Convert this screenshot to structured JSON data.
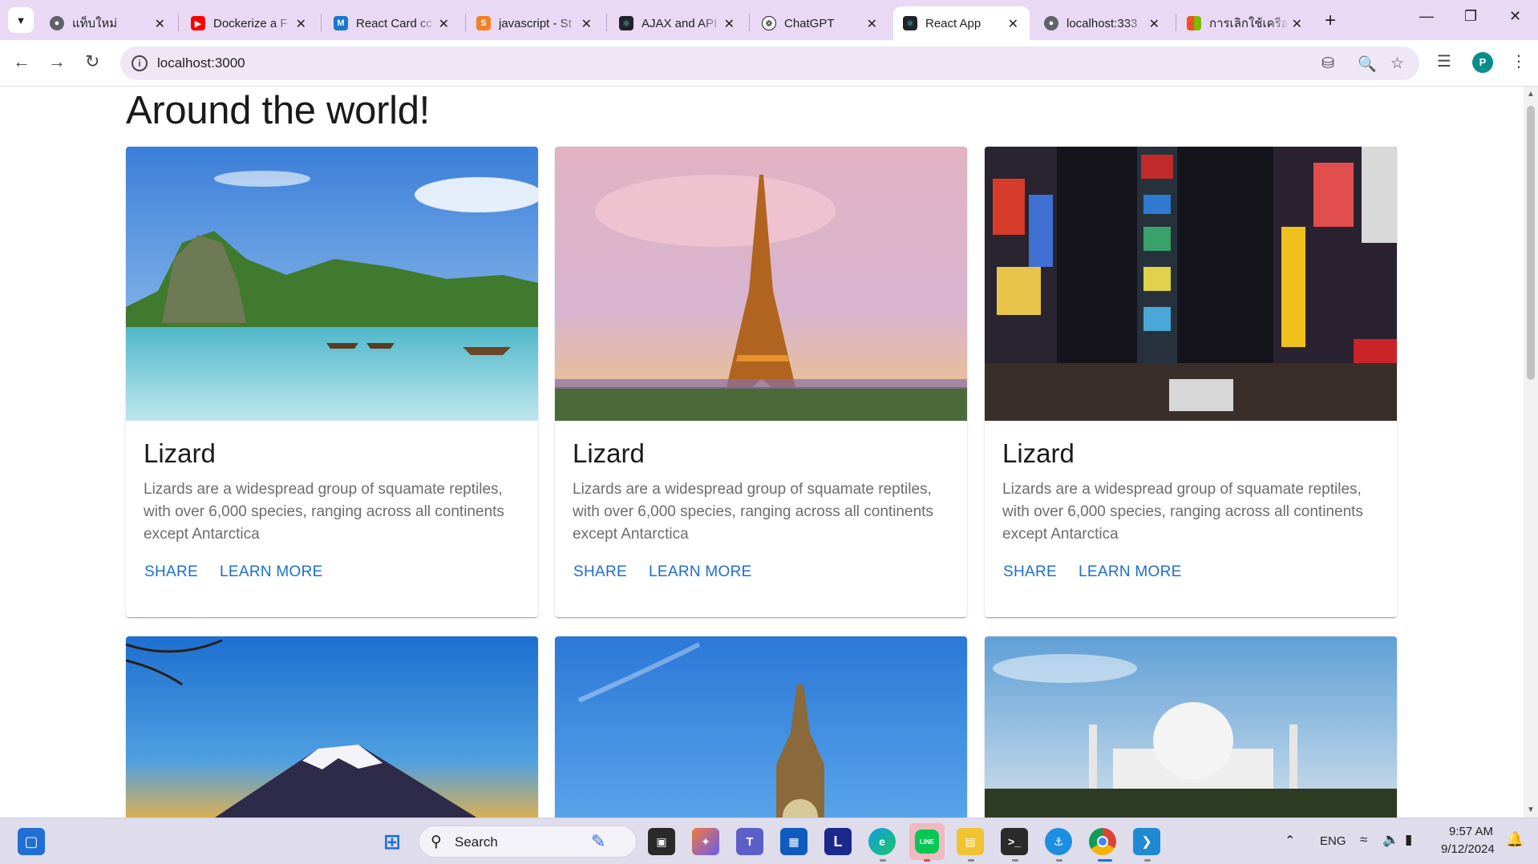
{
  "browser": {
    "tabs": [
      {
        "label": "แท็บใหม่",
        "icon": "chrome-icon",
        "color": "#5f6368"
      },
      {
        "label": "Dockerize a F",
        "icon": "youtube-icon",
        "color": "#ff0000"
      },
      {
        "label": "React Card cc",
        "icon": "mui-icon",
        "color": "#1976d2"
      },
      {
        "label": "javascript - St",
        "icon": "stackoverflow-icon",
        "color": "#f48024"
      },
      {
        "label": "AJAX and API",
        "icon": "react-icon",
        "color": "#20232a"
      },
      {
        "label": "ChatGPT",
        "icon": "openai-icon",
        "color": "#1f1f1f"
      },
      {
        "label": "React App",
        "icon": "react-icon",
        "color": "#20232a"
      },
      {
        "label": "localhost:333",
        "icon": "globe-icon",
        "color": "#5f6368"
      },
      {
        "label": "การเลิกใช้เครือ",
        "icon": "microsoft-icon",
        "color": "#f25022"
      }
    ],
    "active_tab": 6,
    "url": "localhost:3000"
  },
  "page": {
    "title": "Around the world!",
    "cards": [
      {
        "title": "Lizard",
        "description": "Lizards are a widespread group of squamate reptiles, with over 6,000 species, ranging across all continents except Antarctica",
        "share": "SHARE",
        "learn": "LEARN MORE",
        "image": "tropical-island"
      },
      {
        "title": "Lizard",
        "description": "Lizards are a widespread group of squamate reptiles, with over 6,000 species, ranging across all continents except Antarctica",
        "share": "SHARE",
        "learn": "LEARN MORE",
        "image": "eiffel-tower"
      },
      {
        "title": "Lizard",
        "description": "Lizards are a widespread group of squamate reptiles, with over 6,000 species, ranging across all continents except Antarctica",
        "share": "SHARE",
        "learn": "LEARN MORE",
        "image": "times-square"
      }
    ],
    "row2_images": [
      "mount-fuji",
      "big-ben",
      "taj-mahal"
    ]
  },
  "taskbar": {
    "search_label": "Search",
    "language": "ENG",
    "time": "9:57 AM",
    "date": "9/12/2024",
    "line_label": "LINE",
    "l_app_label": "L"
  },
  "colors": {
    "link": "#1d6fc9",
    "tabstrip": "#e9d9f5",
    "omnibox": "#efe7f5"
  }
}
